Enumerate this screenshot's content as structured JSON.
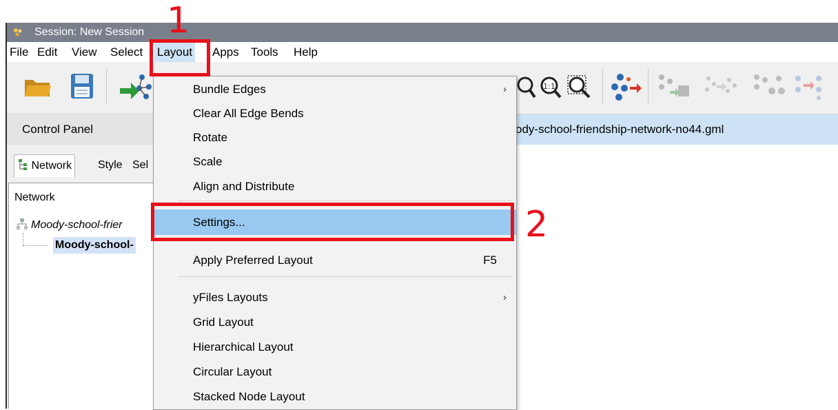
{
  "window": {
    "title": "Session: New Session"
  },
  "menubar": {
    "items": [
      "File",
      "Edit",
      "View",
      "Select",
      "Layout",
      "Apps",
      "Tools",
      "Help"
    ],
    "active": "Layout"
  },
  "toolbar": {
    "left_icons": [
      "open-folder-icon",
      "save-icon",
      "import-network-icon"
    ],
    "right_icons": [
      "zoom-in-icon",
      "zoom-actual-size-icon",
      "zoom-fit-icon",
      "apply-layout-icon",
      "first-neighbors-icon",
      "hide-selected-icon",
      "show-all-icon",
      "select-neighbors-icon"
    ]
  },
  "control_panel": {
    "title": "Control Panel",
    "tabs": {
      "network": "Network",
      "style": "Style",
      "select": "Sel"
    },
    "header": "Network",
    "collection_name": "Moody-school-frier",
    "network_name": "Moody-school-"
  },
  "content": {
    "title": "ody-school-friendship-network-no44.gml"
  },
  "layout_menu": {
    "items": {
      "bundle_edges": "Bundle Edges",
      "clear_edge_bends": "Clear All Edge Bends",
      "rotate": "Rotate",
      "scale": "Scale",
      "align": "Align and Distribute",
      "settings": "Settings...",
      "apply_preferred": "Apply Preferred Layout",
      "apply_preferred_shortcut": "F5",
      "yfiles": "yFiles Layouts",
      "grid": "Grid Layout",
      "hierarchical": "Hierarchical Layout",
      "circular": "Circular Layout",
      "stacked": "Stacked Node Layout"
    },
    "highlighted": "Settings..."
  },
  "annotations": {
    "step1": "1",
    "step2": "2"
  },
  "colors": {
    "annotation": "#e8101a",
    "highlight": "#99c9f1",
    "titlebar": "#7a7f8c"
  }
}
